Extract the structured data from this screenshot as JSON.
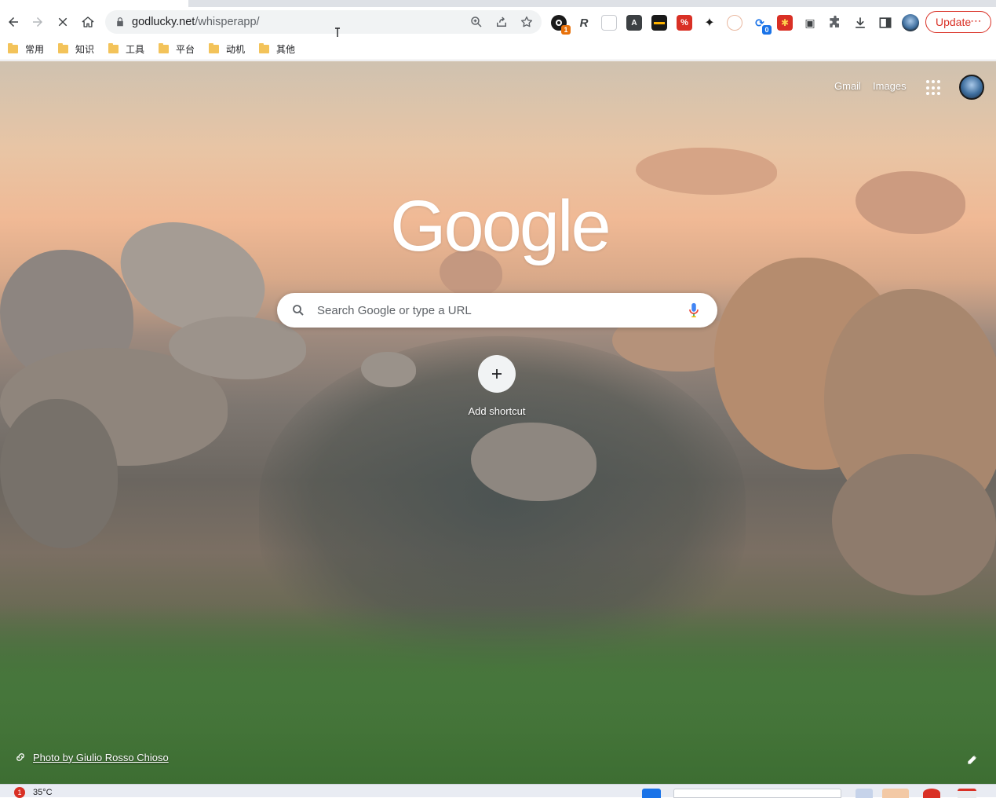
{
  "browser": {
    "address_host": "godlucky.net",
    "address_path": "/whisperapp/",
    "update_label": "Update",
    "extensions": [
      {
        "name": "extension-1",
        "badge": "1"
      },
      {
        "name": "extension-2",
        "badge": ""
      },
      {
        "name": "extension-3",
        "badge": ""
      },
      {
        "name": "extension-4",
        "badge": ""
      },
      {
        "name": "extension-5",
        "badge": ""
      },
      {
        "name": "extension-6",
        "badge": ""
      },
      {
        "name": "extension-7",
        "badge": ""
      },
      {
        "name": "extension-8",
        "badge": ""
      },
      {
        "name": "extension-9",
        "badge": "0"
      },
      {
        "name": "extension-10",
        "badge": ""
      }
    ]
  },
  "bookmarks": [
    {
      "label": "常用"
    },
    {
      "label": "知识"
    },
    {
      "label": "工具"
    },
    {
      "label": "平台"
    },
    {
      "label": "动机"
    },
    {
      "label": "其他"
    }
  ],
  "ntp": {
    "gmail_label": "Gmail",
    "images_label": "Images",
    "logo_text": "Google",
    "search_placeholder": "Search Google or type a URL",
    "add_shortcut_label": "Add shortcut",
    "photo_attribution": "Photo by Giulio Rosso Chioso"
  },
  "taskbar": {
    "weather_badge": "1",
    "weather_temp": "35°C"
  },
  "colors": {
    "update_red": "#d93025",
    "folder_yellow": "#f3c35a",
    "mic_blue": "#4285f4"
  }
}
